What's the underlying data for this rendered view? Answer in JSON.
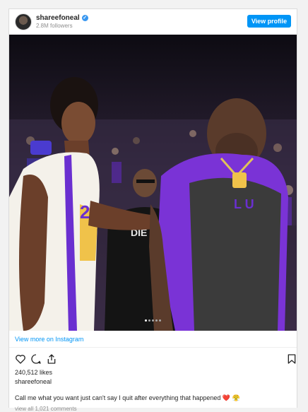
{
  "header": {
    "username": "shareefoneal",
    "followers": "2.8M followers",
    "view_profile": "View profile",
    "verified_icon": "✓"
  },
  "post": {
    "photo_desc_icon": "post-photo",
    "carousel_dots": 5,
    "active_dot": 1,
    "view_more": "View more on Instagram",
    "likes": "240,512 likes",
    "author": "shareefoneal",
    "caption": "Call me what you want just can't say I quit after everything that happened",
    "caption_emoji": "❤️ 😤",
    "view_comments": "view all 1,021 comments"
  },
  "icons": {
    "like": "heart-icon",
    "comment": "comment-icon",
    "share": "share-icon",
    "save": "bookmark-icon"
  },
  "colors": {
    "accent": "#0095f6",
    "lsu_purple": "#6a2fd0",
    "lsu_gold": "#f0c24a"
  }
}
